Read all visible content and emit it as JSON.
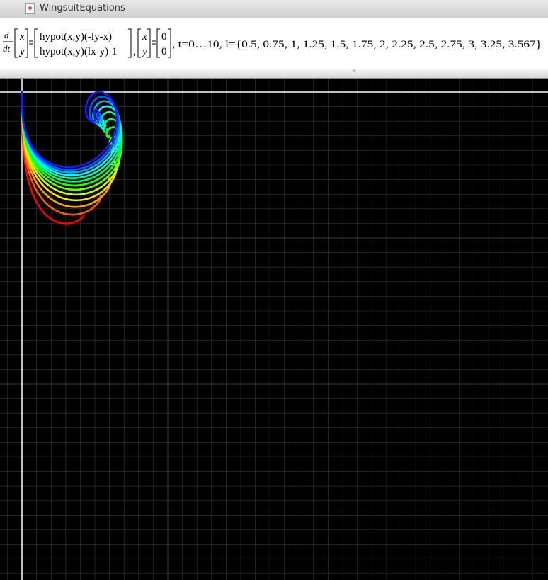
{
  "window": {
    "title": "WingsuitEquations",
    "icon": "document-icon"
  },
  "formula": {
    "d": "d",
    "dt": "dt",
    "x": "x",
    "y": "y",
    "rhs_top": "hypot(x,y)(-ly-x)",
    "rhs_bottom": "hypot(x,y)(lx-y)-1",
    "init_x": "0",
    "init_y": "0",
    "range": ", t=0…10, l={0.5, 0.75, 1, 1.25, 1.5, 1.75, 2, 2.25, 2.5, 2.75, 3, 3.25, 3.567}"
  },
  "splitter": {
    "grip": "ˆ"
  },
  "chart_data": {
    "type": "line",
    "title": "",
    "xlabel": "",
    "ylabel": "",
    "t_range": [
      0,
      10
    ],
    "initial_condition": [
      0,
      0
    ],
    "parameter": "l",
    "series": [
      {
        "l": 0.5,
        "color": "#ff0000"
      },
      {
        "l": 0.75,
        "color": "#ff5a00"
      },
      {
        "l": 1,
        "color": "#ffa500"
      },
      {
        "l": 1.25,
        "color": "#ffe000"
      },
      {
        "l": 1.5,
        "color": "#c8ff00"
      },
      {
        "l": 1.75,
        "color": "#6cff00"
      },
      {
        "l": 2,
        "color": "#1aff1a"
      },
      {
        "l": 2.25,
        "color": "#00ff60"
      },
      {
        "l": 2.5,
        "color": "#00ffb0"
      },
      {
        "l": 2.75,
        "color": "#00ffff"
      },
      {
        "l": 3,
        "color": "#00b0ff"
      },
      {
        "l": 3.25,
        "color": "#0060ff"
      },
      {
        "l": 3.567,
        "color": "#1a1aff"
      }
    ],
    "grid": true,
    "axes_color": "#ffffff",
    "grid_color": "#3a3a3a"
  }
}
